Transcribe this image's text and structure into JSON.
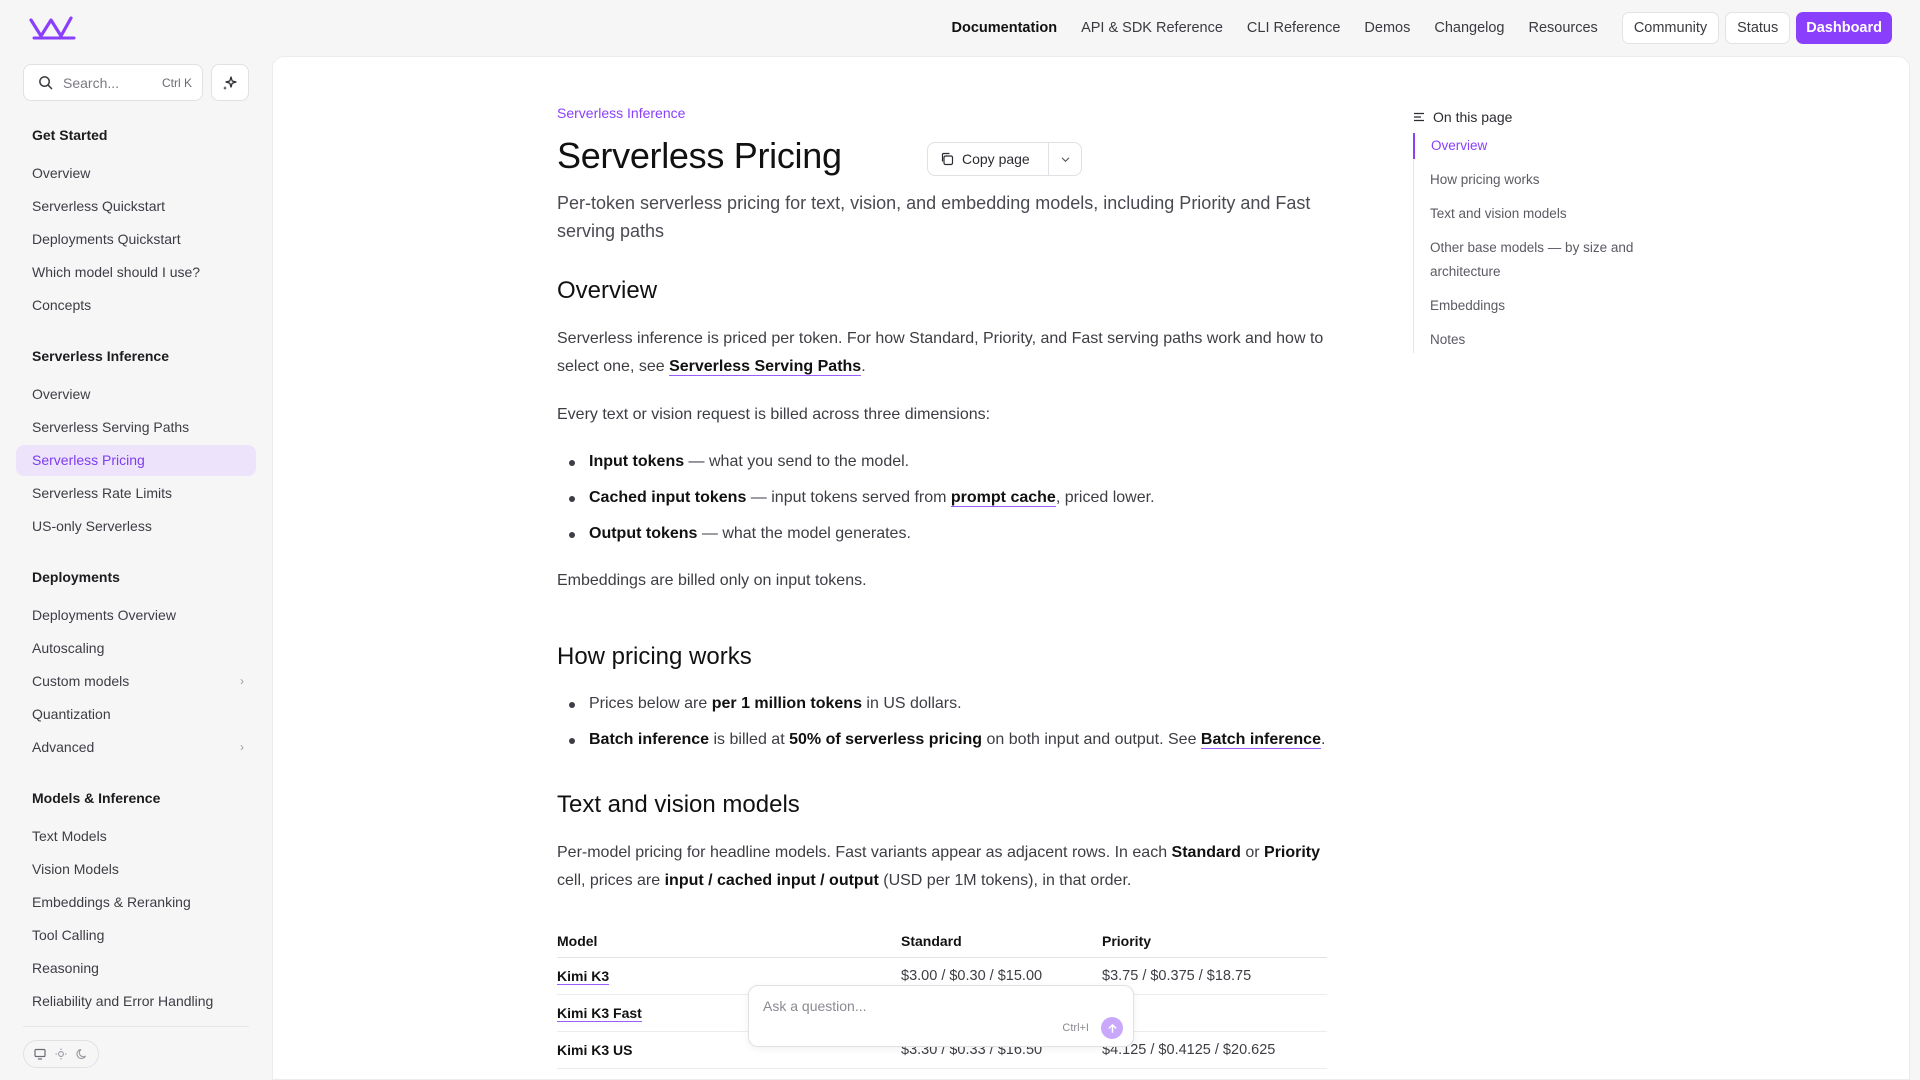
{
  "colors": {
    "accent": "#8a3ffc",
    "active_bg": "#ede4fb"
  },
  "topnav": {
    "links": [
      "Documentation",
      "API & SDK Reference",
      "CLI Reference",
      "Demos",
      "Changelog",
      "Resources"
    ],
    "community": "Community",
    "status": "Status",
    "dashboard": "Dashboard"
  },
  "search": {
    "placeholder": "Search...",
    "shortcut": "Ctrl K"
  },
  "sidebar": {
    "groups": [
      {
        "title": "Get Started",
        "items": [
          "Overview",
          "Serverless Quickstart",
          "Deployments Quickstart",
          "Which model should I use?",
          "Concepts"
        ]
      },
      {
        "title": "Serverless Inference",
        "items": [
          "Overview",
          "Serverless Serving Paths",
          "Serverless Pricing",
          "Serverless Rate Limits",
          "US-only Serverless"
        ]
      },
      {
        "title": "Deployments",
        "items": [
          "Deployments Overview",
          "Autoscaling",
          "Custom models",
          "Quantization",
          "Advanced"
        ]
      },
      {
        "title": "Models & Inference",
        "items": [
          "Text Models",
          "Vision Models",
          "Embeddings & Reranking",
          "Tool Calling",
          "Reasoning",
          "Reliability and Error Handling"
        ]
      }
    ],
    "active_item": "Serverless Pricing"
  },
  "page": {
    "breadcrumb": "Serverless Inference",
    "title": "Serverless Pricing",
    "subtitle": "Per-token serverless pricing for text, vision, and embedding models, including Priority and Fast serving paths",
    "copy_label": "Copy page"
  },
  "overview": {
    "heading": "Overview",
    "p1_pre": "Serverless inference is priced per token. For how Standard, Priority, and Fast serving paths work and how to select one, see ",
    "p1_link": "Serverless Serving Paths",
    "p1_post": ".",
    "p2": "Every text or vision request is billed across three dimensions:",
    "b1_bold": "Input tokens",
    "b1_rest": " — what you send to the model.",
    "b2_bold": "Cached input tokens",
    "b2_mid": " — input tokens served from ",
    "b2_link": "prompt cache",
    "b2_post": ", priced lower.",
    "b3_bold": "Output tokens",
    "b3_rest": " — what the model generates.",
    "p3": "Embeddings are billed only on input tokens."
  },
  "pricing": {
    "heading": "How pricing works",
    "b1_pre": "Prices below are ",
    "b1_bold": "per 1 million tokens",
    "b1_post": " in US dollars.",
    "b2_bold1": "Batch inference",
    "b2_mid": " is billed at ",
    "b2_bold2": "50% of serverless pricing",
    "b2_post": " on both input and output. See ",
    "b2_link": "Batch inference",
    "b2_end": "."
  },
  "textvision": {
    "heading": "Text and vision models",
    "p_pre": "Per-model pricing for headline models. Fast variants appear as adjacent rows. In each ",
    "p_b1": "Standard",
    "p_or": " or ",
    "p_b2": "Priority",
    "p_mid": " cell, prices are ",
    "p_b3": "input / cached input / output",
    "p_post": " (USD per 1M tokens), in that order.",
    "columns": [
      "Model",
      "Standard",
      "Priority"
    ],
    "rows": [
      {
        "model": "Kimi K3",
        "standard": "$3.00 / $0.30 / $15.00",
        "priority": "$3.75 / $0.375 / $18.75"
      },
      {
        "model": "Kimi K3 Fast",
        "standard": "",
        "priority": ""
      },
      {
        "model": "Kimi K3 US",
        "standard": "$3.30 / $0.33 / $16.50",
        "priority": "$4.125 / $0.4125 / $20.625"
      }
    ]
  },
  "toc": {
    "title": "On this page",
    "items": [
      "Overview",
      "How pricing works",
      "Text and vision models",
      "Other base models — by size and architecture",
      "Embeddings",
      "Notes"
    ]
  },
  "ask": {
    "placeholder": "Ask a question...",
    "shortcut": "Ctrl+I"
  }
}
